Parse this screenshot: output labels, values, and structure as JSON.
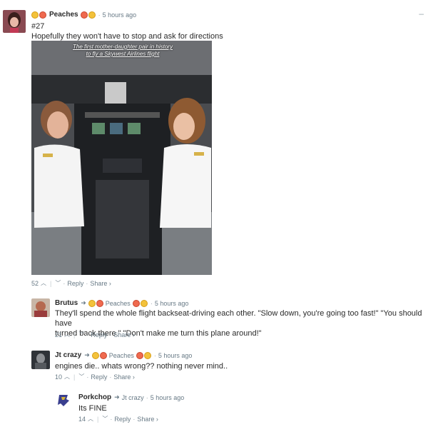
{
  "comments": [
    {
      "username": "Peaches",
      "timestamp": "5 hours ago",
      "lines": [
        "#27",
        "Hopefully they won't have to stop and ask for directions"
      ],
      "image_caption": [
        "The first mother-daughter pair in history",
        "to fly a Skywest Airlines flight"
      ],
      "votes": "52",
      "reply": "Reply",
      "share": "Share ›"
    },
    {
      "username": "Brutus",
      "reply_to": "Peaches",
      "timestamp": "5 hours ago",
      "lines": [
        "They'll spend the whole flight backseat-driving each other. \"Slow down, you're going too fast!\" \"You should have",
        "turned back there.\" \"Don't make me turn this plane around!\""
      ],
      "votes": "21",
      "reply": "Reply",
      "share": "Share ›"
    },
    {
      "username": "Jt crazy",
      "reply_to": "Peaches",
      "timestamp": "5 hours ago",
      "lines": [
        "engines die.. whats wrong?? nothing never mind.."
      ],
      "votes": "10",
      "reply": "Reply",
      "share": "Share ›"
    },
    {
      "username": "Porkchop",
      "reply_to": "Jt crazy",
      "timestamp": "5 hours ago",
      "lines": [
        "Its FINE"
      ],
      "votes": "14",
      "reply": "Reply",
      "share": "Share ›"
    }
  ],
  "icons": {
    "upvote": "chevron-up-icon",
    "downvote": "chevron-down-icon",
    "reply_arrow": "arrow-right-icon",
    "collapse": "minus-icon"
  },
  "colors": {
    "meta_text": "#687a86",
    "body_text": "#2a2a2a",
    "emoji_yellow": "#f3c23b",
    "emoji_red": "#ef6a4f"
  }
}
